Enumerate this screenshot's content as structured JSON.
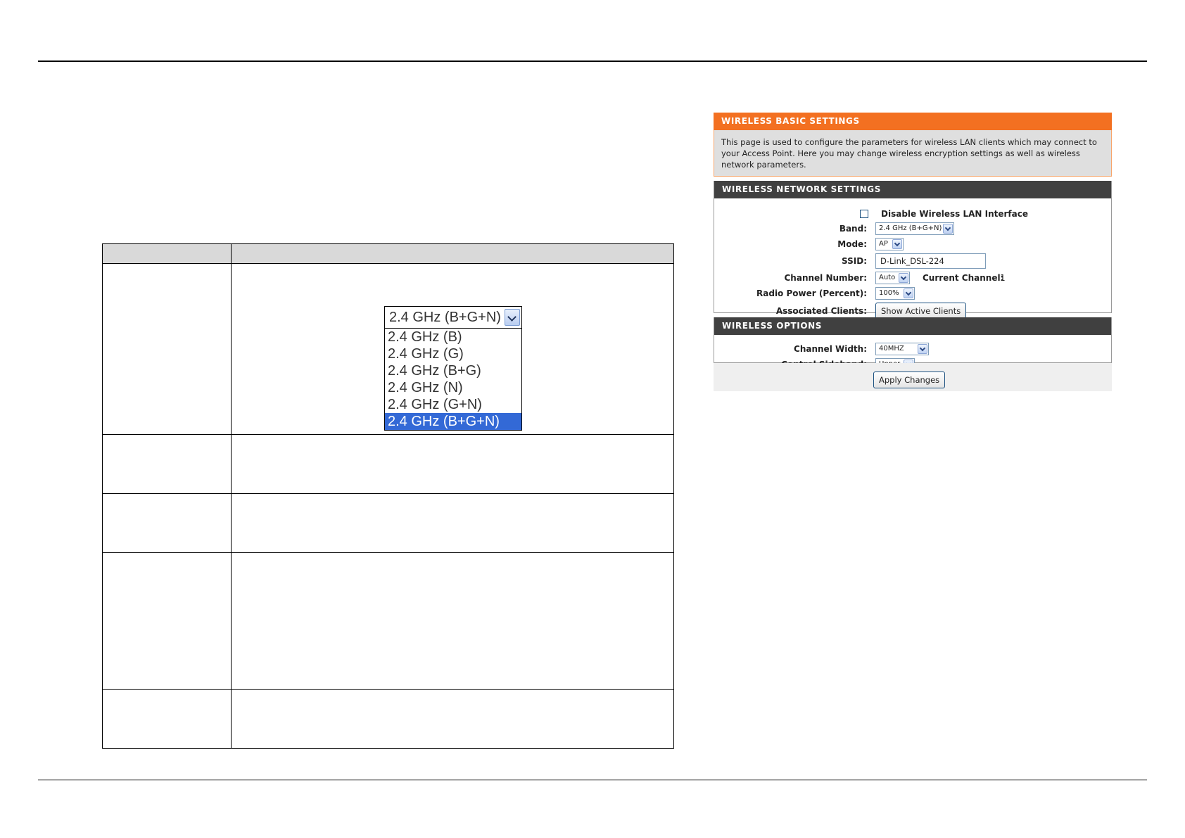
{
  "band_dropdown": {
    "selected": "2.4 GHz (B+G+N)",
    "options": [
      "2.4 GHz (B)",
      "2.4 GHz (G)",
      "2.4 GHz (B+G)",
      "2.4 GHz (N)",
      "2.4 GHz (G+N)",
      "2.4 GHz (B+G+N)"
    ]
  },
  "panel": {
    "basic_title": "WIRELESS BASIC SETTINGS",
    "basic_desc": "This page is used to configure the parameters for wireless LAN clients which may connect to your Access Point. Here you may change wireless encryption settings as well as wireless network parameters.",
    "network_title": "WIRELESS NETWORK SETTINGS",
    "disable_label": "Disable Wireless LAN Interface",
    "band_label": "Band:",
    "band_value": "2.4 GHz (B+G+N)",
    "mode_label": "Mode:",
    "mode_value": "AP",
    "ssid_label": "SSID:",
    "ssid_value": "D-Link_DSL-224",
    "channel_label": "Channel Number:",
    "channel_value": "Auto",
    "current_channel_label": "Current Channel:",
    "current_channel_value": "1",
    "power_label": "Radio Power (Percent):",
    "power_value": "100%",
    "clients_label": "Associated Clients:",
    "clients_button": "Show Active Clients",
    "options_title": "WIRELESS OPTIONS",
    "width_label": "Channel Width:",
    "width_value": "40MHZ",
    "sideband_label": "Control Sideband:",
    "sideband_value": "Upper",
    "apply_button": "Apply Changes"
  }
}
